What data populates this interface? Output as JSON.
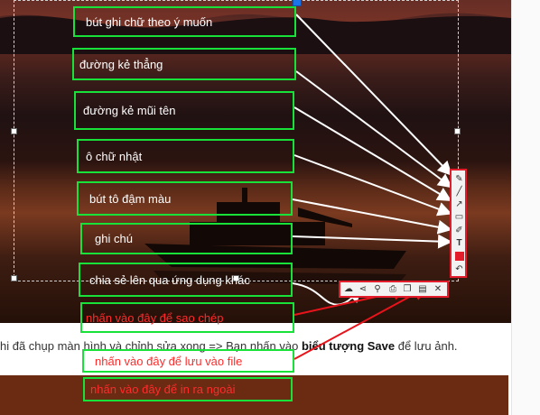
{
  "annotations": {
    "pen_label": "bút ghi chữ theo ý muốn",
    "line_label": "đường kẻ thẳng",
    "arrow_label": "đường kẻ mũi tên",
    "rect_label": "ô chữ nhật",
    "highlighter_label": "bút tô đậm màu",
    "note_label": "ghi chú",
    "share_label": "chia sẻ lên qua ứng dụng khác",
    "copy_label": "nhấn vào đây để sao chép",
    "save_label": "nhấn vào đây để lưu vào file",
    "print_label": "nhấn vào đây để in ra ngoài"
  },
  "article": {
    "text_before": "hi đã chụp màn hình và chỉnh sửa xong => Bạn nhấn vào ",
    "bold": "biểu tượng Save",
    "text_after": " để lưu ảnh."
  },
  "toolbar_vertical": {
    "tools": [
      {
        "name": "pencil-icon",
        "glyph": "✎"
      },
      {
        "name": "line-icon",
        "glyph": "╱"
      },
      {
        "name": "arrow-icon",
        "glyph": "↗"
      },
      {
        "name": "rectangle-icon",
        "glyph": "▭"
      },
      {
        "name": "highlighter-icon",
        "glyph": "✐"
      },
      {
        "name": "text-icon",
        "glyph": "T"
      },
      {
        "name": "color-picker-icon",
        "glyph": ""
      },
      {
        "name": "undo-icon",
        "glyph": "↶"
      }
    ],
    "color": "#e31d2c"
  },
  "toolbar_horizontal": {
    "tools": [
      {
        "name": "upload-cloud-icon",
        "glyph": "☁"
      },
      {
        "name": "share-icon",
        "glyph": "⋖"
      },
      {
        "name": "search-icon",
        "glyph": "⚲"
      },
      {
        "name": "print-icon",
        "glyph": "⎙"
      },
      {
        "name": "copy-icon",
        "glyph": "❐"
      },
      {
        "name": "save-icon",
        "glyph": "▤"
      },
      {
        "name": "close-icon",
        "glyph": "✕"
      }
    ]
  },
  "colors": {
    "annotation_border": "#18e23a",
    "annotation_red_text": "#ff2b2b",
    "toolbar_border": "#e31d2c",
    "arrow_red": "#e8141b"
  }
}
